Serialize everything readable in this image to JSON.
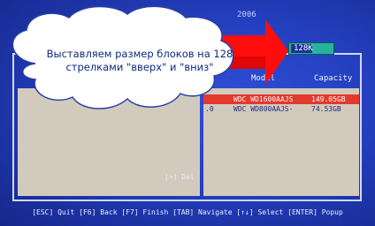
{
  "bios": {
    "top_text": "2006",
    "headers": {
      "model": "Model",
      "capacity": "Capacity"
    },
    "drives": [
      {
        "num": "",
        "model": "WDC WD1600AAJS",
        "capacity": "149.05GB",
        "selected": true
      },
      {
        "num": ".0",
        "model": "WDC WD800AAJS-",
        "capacity": "74.53GB",
        "selected": false
      }
    ],
    "value_box": "128K",
    "del_label": "[+] Del",
    "footer": "[ESC] Quit [F6] Back [F7] Finish [TAB] Navigate [↑↓] Select [ENTER] Popup"
  },
  "callout": {
    "line1": "Выставляем размер блоков на 128",
    "line2": "стрелками \"вверх\" и \"вниз\""
  },
  "colors": {
    "bios_background": "#2440c0",
    "panel": "#d2cabd",
    "selected_row": "#e23a2c",
    "value_box": "#27b39a",
    "arrow": "#ff0000",
    "bubble_text": "#0d2a7d"
  }
}
